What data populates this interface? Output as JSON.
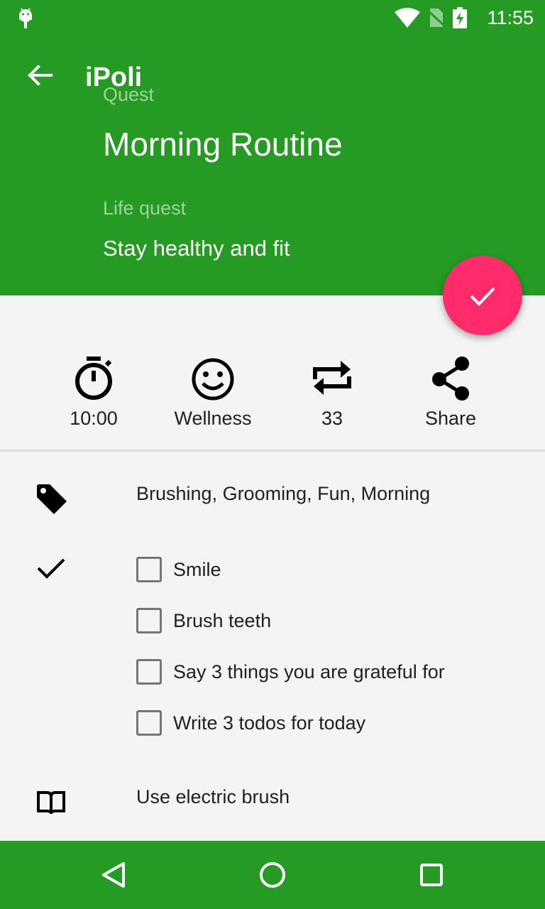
{
  "status_bar": {
    "time": "11:55",
    "icons": [
      "android-icon",
      "wifi-icon",
      "no-sim-icon",
      "battery-charging-icon"
    ]
  },
  "header": {
    "app_title": "iPoli",
    "quest_label": "Quest",
    "quest_title": "Morning Routine",
    "life_quest_label": "Life quest",
    "life_quest_value": "Stay healthy and fit",
    "background_color": "#259b24"
  },
  "fab": {
    "icon": "check-icon",
    "color": "#ff2b6b"
  },
  "actions": [
    {
      "icon": "timer-icon",
      "label": "10:00"
    },
    {
      "icon": "smiley-icon",
      "label": "Wellness"
    },
    {
      "icon": "repeat-icon",
      "label": "33"
    },
    {
      "icon": "share-icon",
      "label": "Share"
    }
  ],
  "tags": {
    "icon": "tag-icon",
    "text": "Brushing, Grooming, Fun, Morning"
  },
  "sub_quests": {
    "icon": "check-icon",
    "items": [
      {
        "label": "Smile",
        "checked": false
      },
      {
        "label": "Brush teeth",
        "checked": false
      },
      {
        "label": "Say 3 things you are grateful for",
        "checked": false
      },
      {
        "label": "Write 3 todos for today",
        "checked": false
      }
    ]
  },
  "note": {
    "icon": "book-icon",
    "text": "Use electric brush"
  },
  "nav_bar": {
    "buttons": [
      "back-triangle-icon",
      "home-circle-icon",
      "recents-square-icon"
    ]
  }
}
